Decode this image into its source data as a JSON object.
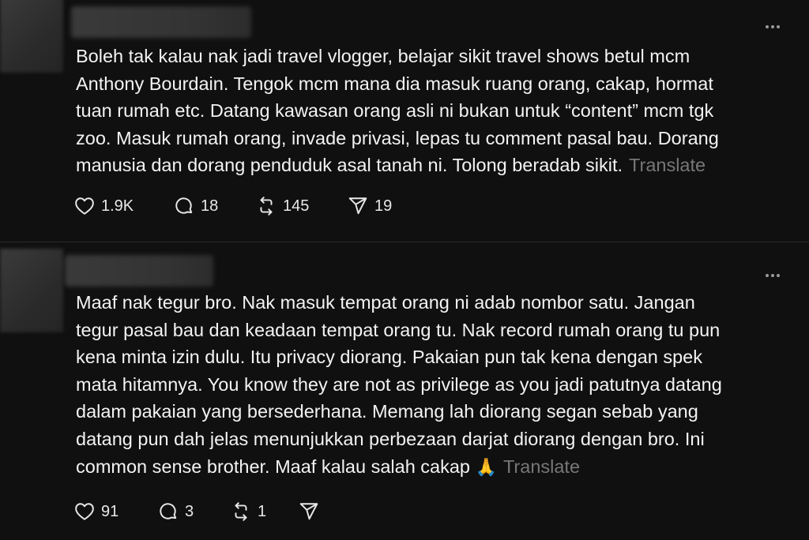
{
  "posts": [
    {
      "text": "Boleh tak kalau nak jadi travel vlogger, belajar sikit travel shows betul mcm\nAnthony Bourdain. Tengok mcm mana dia masuk ruang orang, cakap, hormat\ntuan rumah etc. Datang kawasan orang asli ni bukan untuk “content” mcm tgk\nzoo. Masuk rumah orang, invade privasi, lepas tu comment pasal bau. Dorang\nmanusia dan dorang penduduk asal tanah ni. Tolong beradab sikit.",
      "translate": "Translate",
      "likes": "1.9K",
      "replies": "18",
      "reposts": "145",
      "shares": "19"
    },
    {
      "text": "Maaf nak tegur bro. Nak masuk tempat orang ni adab nombor satu. Jangan\ntegur pasal bau dan keadaan tempat orang tu. Nak record rumah orang tu pun\nkena minta izin dulu. Itu privacy diorang. Pakaian pun tak kena dengan spek\nmata hitamnya. You know they are not as privilege as you jadi patutnya datang\ndalam pakaian yang bersederhana. Memang lah diorang segan sebab yang\ndatang pun dah jelas menunjukkan perbezaan darjat diorang dengan bro. Ini\ncommon sense brother. Maaf kalau salah cakap",
      "emoji": "🙏",
      "translate": "Translate",
      "likes": "91",
      "replies": "3",
      "reposts": "1",
      "shares": ""
    }
  ],
  "icons": {
    "like": "heart-icon",
    "reply": "comment-icon",
    "repost": "repost-icon",
    "share": "send-icon",
    "more": "more-icon"
  }
}
